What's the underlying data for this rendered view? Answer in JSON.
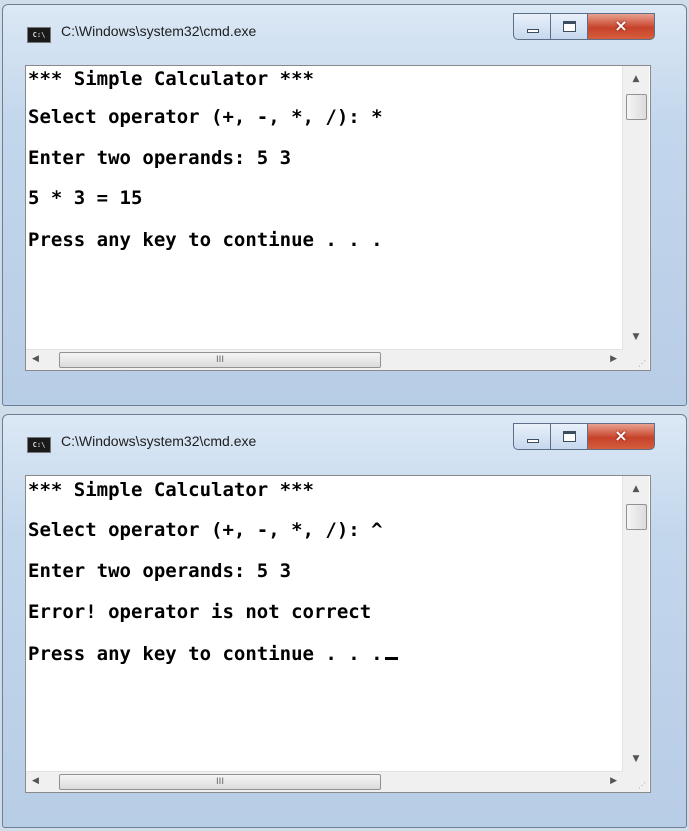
{
  "windows": [
    {
      "title": "C:\\Windows\\system32\\cmd.exe",
      "icon_label": "C:\\",
      "caption_buttons": {
        "minimize": "minimize-icon",
        "maximize": "maximize-icon",
        "close": "×"
      },
      "lines": [
        "*** Simple Calculator ***",
        "Select operator (+, -, *, /): *",
        "Enter two operands: 5 3",
        "5 * 3 = 15",
        "Press any key to continue . . ."
      ],
      "scroll": {
        "up": "▲",
        "down": "▼",
        "left": "◀",
        "right": "▶",
        "grip": "III",
        "corner": "⋰"
      }
    },
    {
      "title": "C:\\Windows\\system32\\cmd.exe",
      "icon_label": "C:\\",
      "caption_buttons": {
        "minimize": "minimize-icon",
        "maximize": "maximize-icon",
        "close": "×"
      },
      "lines": [
        "*** Simple Calculator ***",
        "Select operator (+, -, *, /): ^",
        "Enter two operands: 5 3",
        "Error! operator is not correct",
        "Press any key to continue . . ."
      ],
      "scroll": {
        "up": "▲",
        "down": "▼",
        "left": "◀",
        "right": "▶",
        "grip": "III",
        "corner": "⋰"
      }
    }
  ],
  "colors": {
    "console_bg": "#ffffff",
    "console_text": "#000000",
    "close_button": "#c7422a"
  }
}
